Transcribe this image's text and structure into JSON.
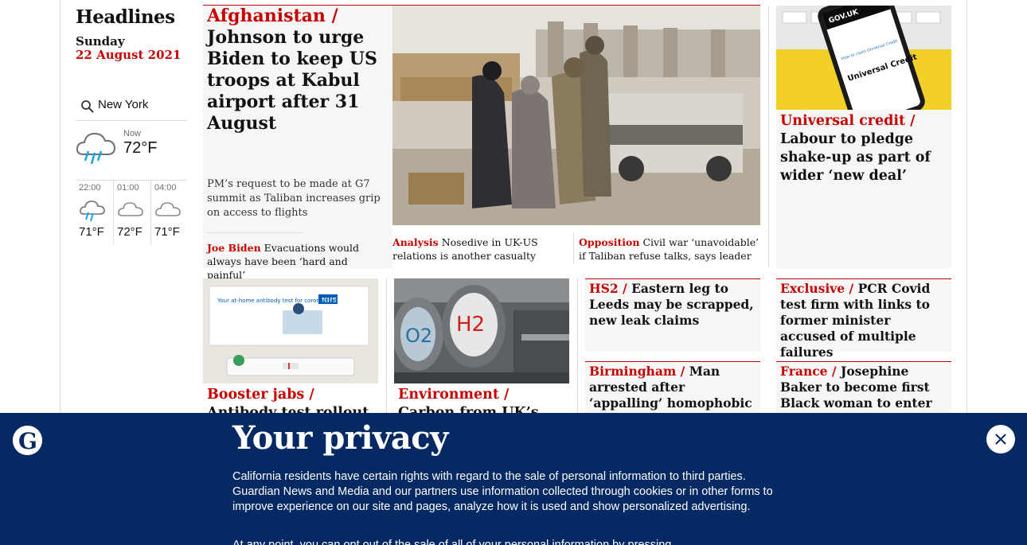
{
  "sidebar": {
    "title": "Headlines",
    "day": "Sunday",
    "date": "22 August 2021",
    "location": "New York",
    "now_label": "Now",
    "now_temp": "72°F",
    "forecast": [
      {
        "time": "22:00",
        "temp": "71°F",
        "icon": "rain-cloud-icon"
      },
      {
        "time": "01:00",
        "temp": "72°F",
        "icon": "cloud-icon"
      },
      {
        "time": "04:00",
        "temp": "71°F",
        "icon": "cloud-icon"
      }
    ]
  },
  "lead": {
    "kicker": "Afghanistan /",
    "headline": "Johnson to urge Biden to keep US troops at Kabul airport after 31 August",
    "standfirst": "PM’s request to be made at G7 summit as Taliban increases grip on access to flights",
    "sublinks": [
      {
        "kicker": "Joe Biden",
        "text": "Evacuations would always have been ‘hard and painful’"
      },
      {
        "kicker": "Analysis",
        "text": "Nosedive in UK-US relations is another casualty"
      },
      {
        "kicker": "Opposition",
        "text": "Civil war ‘unavoidable’ if Taliban refuse talks, says leader"
      }
    ]
  },
  "universal_credit": {
    "kicker": "Universal credit /",
    "headline": "Labour to pledge shake-up as part of wider ‘new deal’",
    "photo_text": [
      "GOV.UK",
      "Universal Credit",
      "How to claim Universal Credit"
    ]
  },
  "booster": {
    "kicker": "Booster jabs /",
    "headline": "Antibody test rollout",
    "photo_text": [
      "Your at-home antibody test for coronavirus",
      "NHS"
    ]
  },
  "environment": {
    "kicker": "Environment /",
    "headline": "Carbon from UK’s blue",
    "photo_text": [
      "O2",
      "H2"
    ]
  },
  "hs2": {
    "kicker": "HS2 /",
    "headline": "Eastern leg to Leeds may be scrapped, new leak claims"
  },
  "birmingham": {
    "kicker": "Birmingham /",
    "headline": "Man arrested after ‘appalling’ homophobic attack in"
  },
  "exclusive": {
    "kicker": "Exclusive /",
    "headline": "PCR Covid test firm with links to former minister accused of multiple failures"
  },
  "france": {
    "kicker": "France /",
    "headline": "Josephine Baker to become first Black woman to enter Pantheon"
  },
  "banner": {
    "title": "Your privacy",
    "body": "California residents have certain rights with regard to the sale of personal information to third parties. Guardian News and Media and our partners use information collected through cookies or in other forms to improve experience on our site and pages, analyze how it is used and show personalized advertising.",
    "body2": "At any point, you can opt out of the sale of all of your personal information by pressing"
  },
  "colors": {
    "brand_red": "#c70000",
    "banner_blue": "#052962"
  }
}
